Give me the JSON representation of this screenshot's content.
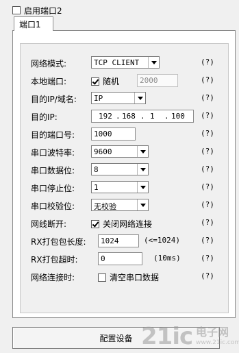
{
  "enable_port2": {
    "label": "启用端口2",
    "checked": false
  },
  "tab": {
    "label": "端口1"
  },
  "fields": {
    "network_mode": {
      "label": "网络模式:",
      "value": "TCP CLIENT",
      "help": "(?)"
    },
    "local_port": {
      "label": "本地端口:",
      "random_label": "随机",
      "random_checked": true,
      "value": "2000",
      "help": "(?)"
    },
    "dest_type": {
      "label": "目的IP/域名:",
      "value": "IP",
      "help": "(?)"
    },
    "dest_ip": {
      "label": "目的IP:",
      "o1": "192",
      "o2": "168",
      "o3": "1",
      "o4": "100",
      "dot": ".",
      "help": "(?)"
    },
    "dest_port": {
      "label": "目的端口号:",
      "value": "1000",
      "help": "(?)"
    },
    "baud": {
      "label": "串口波特率:",
      "value": "9600",
      "help": "(?)"
    },
    "data_bits": {
      "label": "串口数据位:",
      "value": "8",
      "help": "(?)"
    },
    "stop_bits": {
      "label": "串口停止位:",
      "value": "1",
      "help": "(?)"
    },
    "parity": {
      "label": "串口校验位:",
      "value": "无校验",
      "help": "(?)"
    },
    "disconnect": {
      "label": "网线断开:",
      "option_label": "关闭网络连接",
      "checked": true,
      "help": "(?)"
    },
    "pack_len": {
      "label": "RX打包包长度:",
      "value": "1024",
      "note": "(<=1024)",
      "help": "(?)"
    },
    "pack_timeout": {
      "label": "RX打包超时:",
      "value": "0",
      "note": "(10ms)",
      "help": "(?)"
    },
    "on_connect": {
      "label": "网络连接时:",
      "option_label": "清空串口数据",
      "checked": false,
      "help": "(?)"
    }
  },
  "config_button": {
    "label": "配置设备"
  },
  "watermark": {
    "brand": "21ic",
    "cn": "电子网",
    "url": "www.21ic.com"
  }
}
